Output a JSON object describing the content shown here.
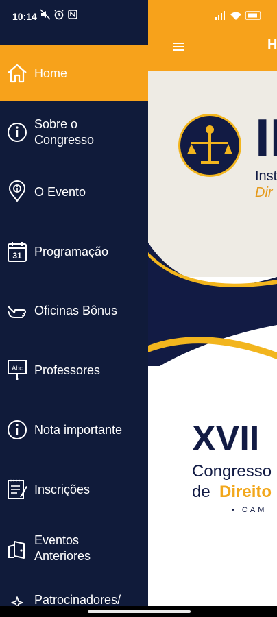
{
  "status_bar": {
    "time": "10:14"
  },
  "app_bar": {
    "title": "H",
    "menu_icon": "hamburger-icon"
  },
  "banner": {
    "logo_letters": "II",
    "logo_line1": "Inst",
    "logo_line2": "Dir",
    "event_number": "XVII",
    "event_line1": "Congresso",
    "event_line2_a": "de ",
    "event_line2_b": "Direito",
    "event_line3": "• CAM"
  },
  "drawer": {
    "items": [
      {
        "label": "Home",
        "icon": "home-icon",
        "active": true
      },
      {
        "label": "Sobre o\nCongresso",
        "icon": "info-icon"
      },
      {
        "label": "O Evento",
        "icon": "location-pin-icon"
      },
      {
        "label": "Programação",
        "icon": "calendar-icon"
      },
      {
        "label": "Oficinas Bônus",
        "icon": "pointing-hand-icon"
      },
      {
        "label": "Professores",
        "icon": "presentation-board-icon"
      },
      {
        "label": "Nota importante",
        "icon": "info-icon"
      },
      {
        "label": "Inscrições",
        "icon": "form-icon"
      },
      {
        "label": "Eventos\nAnteriores",
        "icon": "door-icon"
      },
      {
        "label": "Patrocinadores/",
        "icon": "sparkle-icon"
      }
    ]
  },
  "colors": {
    "accent": "#F7A21B",
    "drawer_bg": "#101B3A",
    "navy": "#121B44"
  }
}
